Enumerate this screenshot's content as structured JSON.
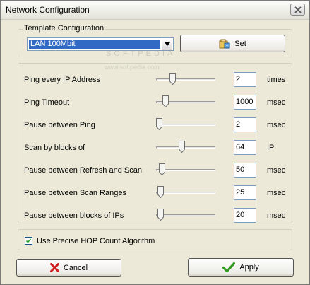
{
  "window": {
    "title": "Network Configuration"
  },
  "template": {
    "group_label": "Template Configuration",
    "selected": "LAN 100Mbit",
    "set_label": "Set"
  },
  "settings": [
    {
      "label": "Ping every IP Address",
      "value": "2",
      "unit": "times",
      "slider_fraction": 0.25
    },
    {
      "label": "Ping Timeout",
      "value": "1000",
      "unit": "msec",
      "slider_fraction": 0.12
    },
    {
      "label": "Pause between Ping",
      "value": "2",
      "unit": "msec",
      "slider_fraction": 0.0
    },
    {
      "label": "Scan by blocks of",
      "value": "64",
      "unit": "IP",
      "slider_fraction": 0.43
    },
    {
      "label": "Pause between Refresh and Scan",
      "value": "50",
      "unit": "msec",
      "slider_fraction": 0.05
    },
    {
      "label": "Pause between Scan Ranges",
      "value": "25",
      "unit": "msec",
      "slider_fraction": 0.03
    },
    {
      "label": "Pause between blocks of IPs",
      "value": "20",
      "unit": "msec",
      "slider_fraction": 0.03
    }
  ],
  "options": {
    "precise_hop_label": "Use Precise HOP Count Algorithm",
    "precise_hop_checked": true
  },
  "actions": {
    "cancel_label": "Cancel",
    "apply_label": "Apply"
  },
  "watermark": {
    "text": "SOFTPEDIA",
    "url": "www.softpedia.com"
  },
  "colors": {
    "selection": "#316ac5",
    "cancel_icon": "#cc1f1f",
    "apply_icon": "#2f9a1f"
  }
}
